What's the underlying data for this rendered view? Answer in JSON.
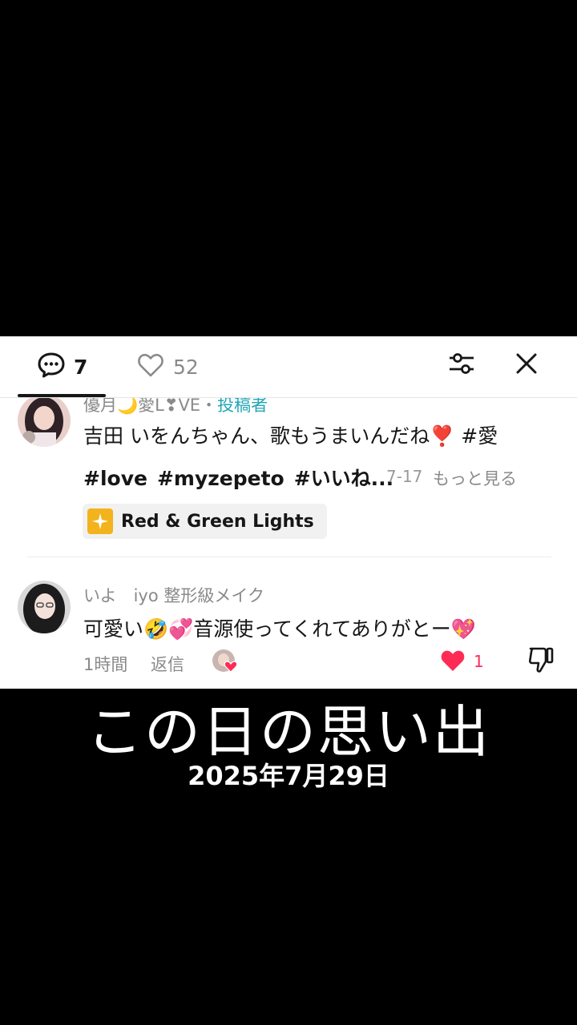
{
  "header": {
    "comment_count": "7",
    "like_count": "52"
  },
  "comments": [
    {
      "username": "優月🌙愛L❣VE",
      "separator": "・",
      "author_tag": "投稿者",
      "line1": "吉田 いをんちゃん、歌もうまいんだね❣️ #愛",
      "hashtags": [
        "#love",
        "#myzepeto",
        "#いいね..."
      ],
      "date": "7-17",
      "more_label": "もっと見る",
      "sound_chip": "Red & Green Lights"
    },
    {
      "username": "いよ　iyo 整形級メイク",
      "text": "可愛い🤣💞音源使ってくれてありがとー💖",
      "time": "1時間",
      "reply_label": "返信",
      "like_count": "1"
    }
  ],
  "overlay": {
    "title": "この日の思い出",
    "date": "2025年7月29日"
  },
  "colors": {
    "author_tag": "#22a7b5",
    "liked_heart": "#fe2c55"
  }
}
